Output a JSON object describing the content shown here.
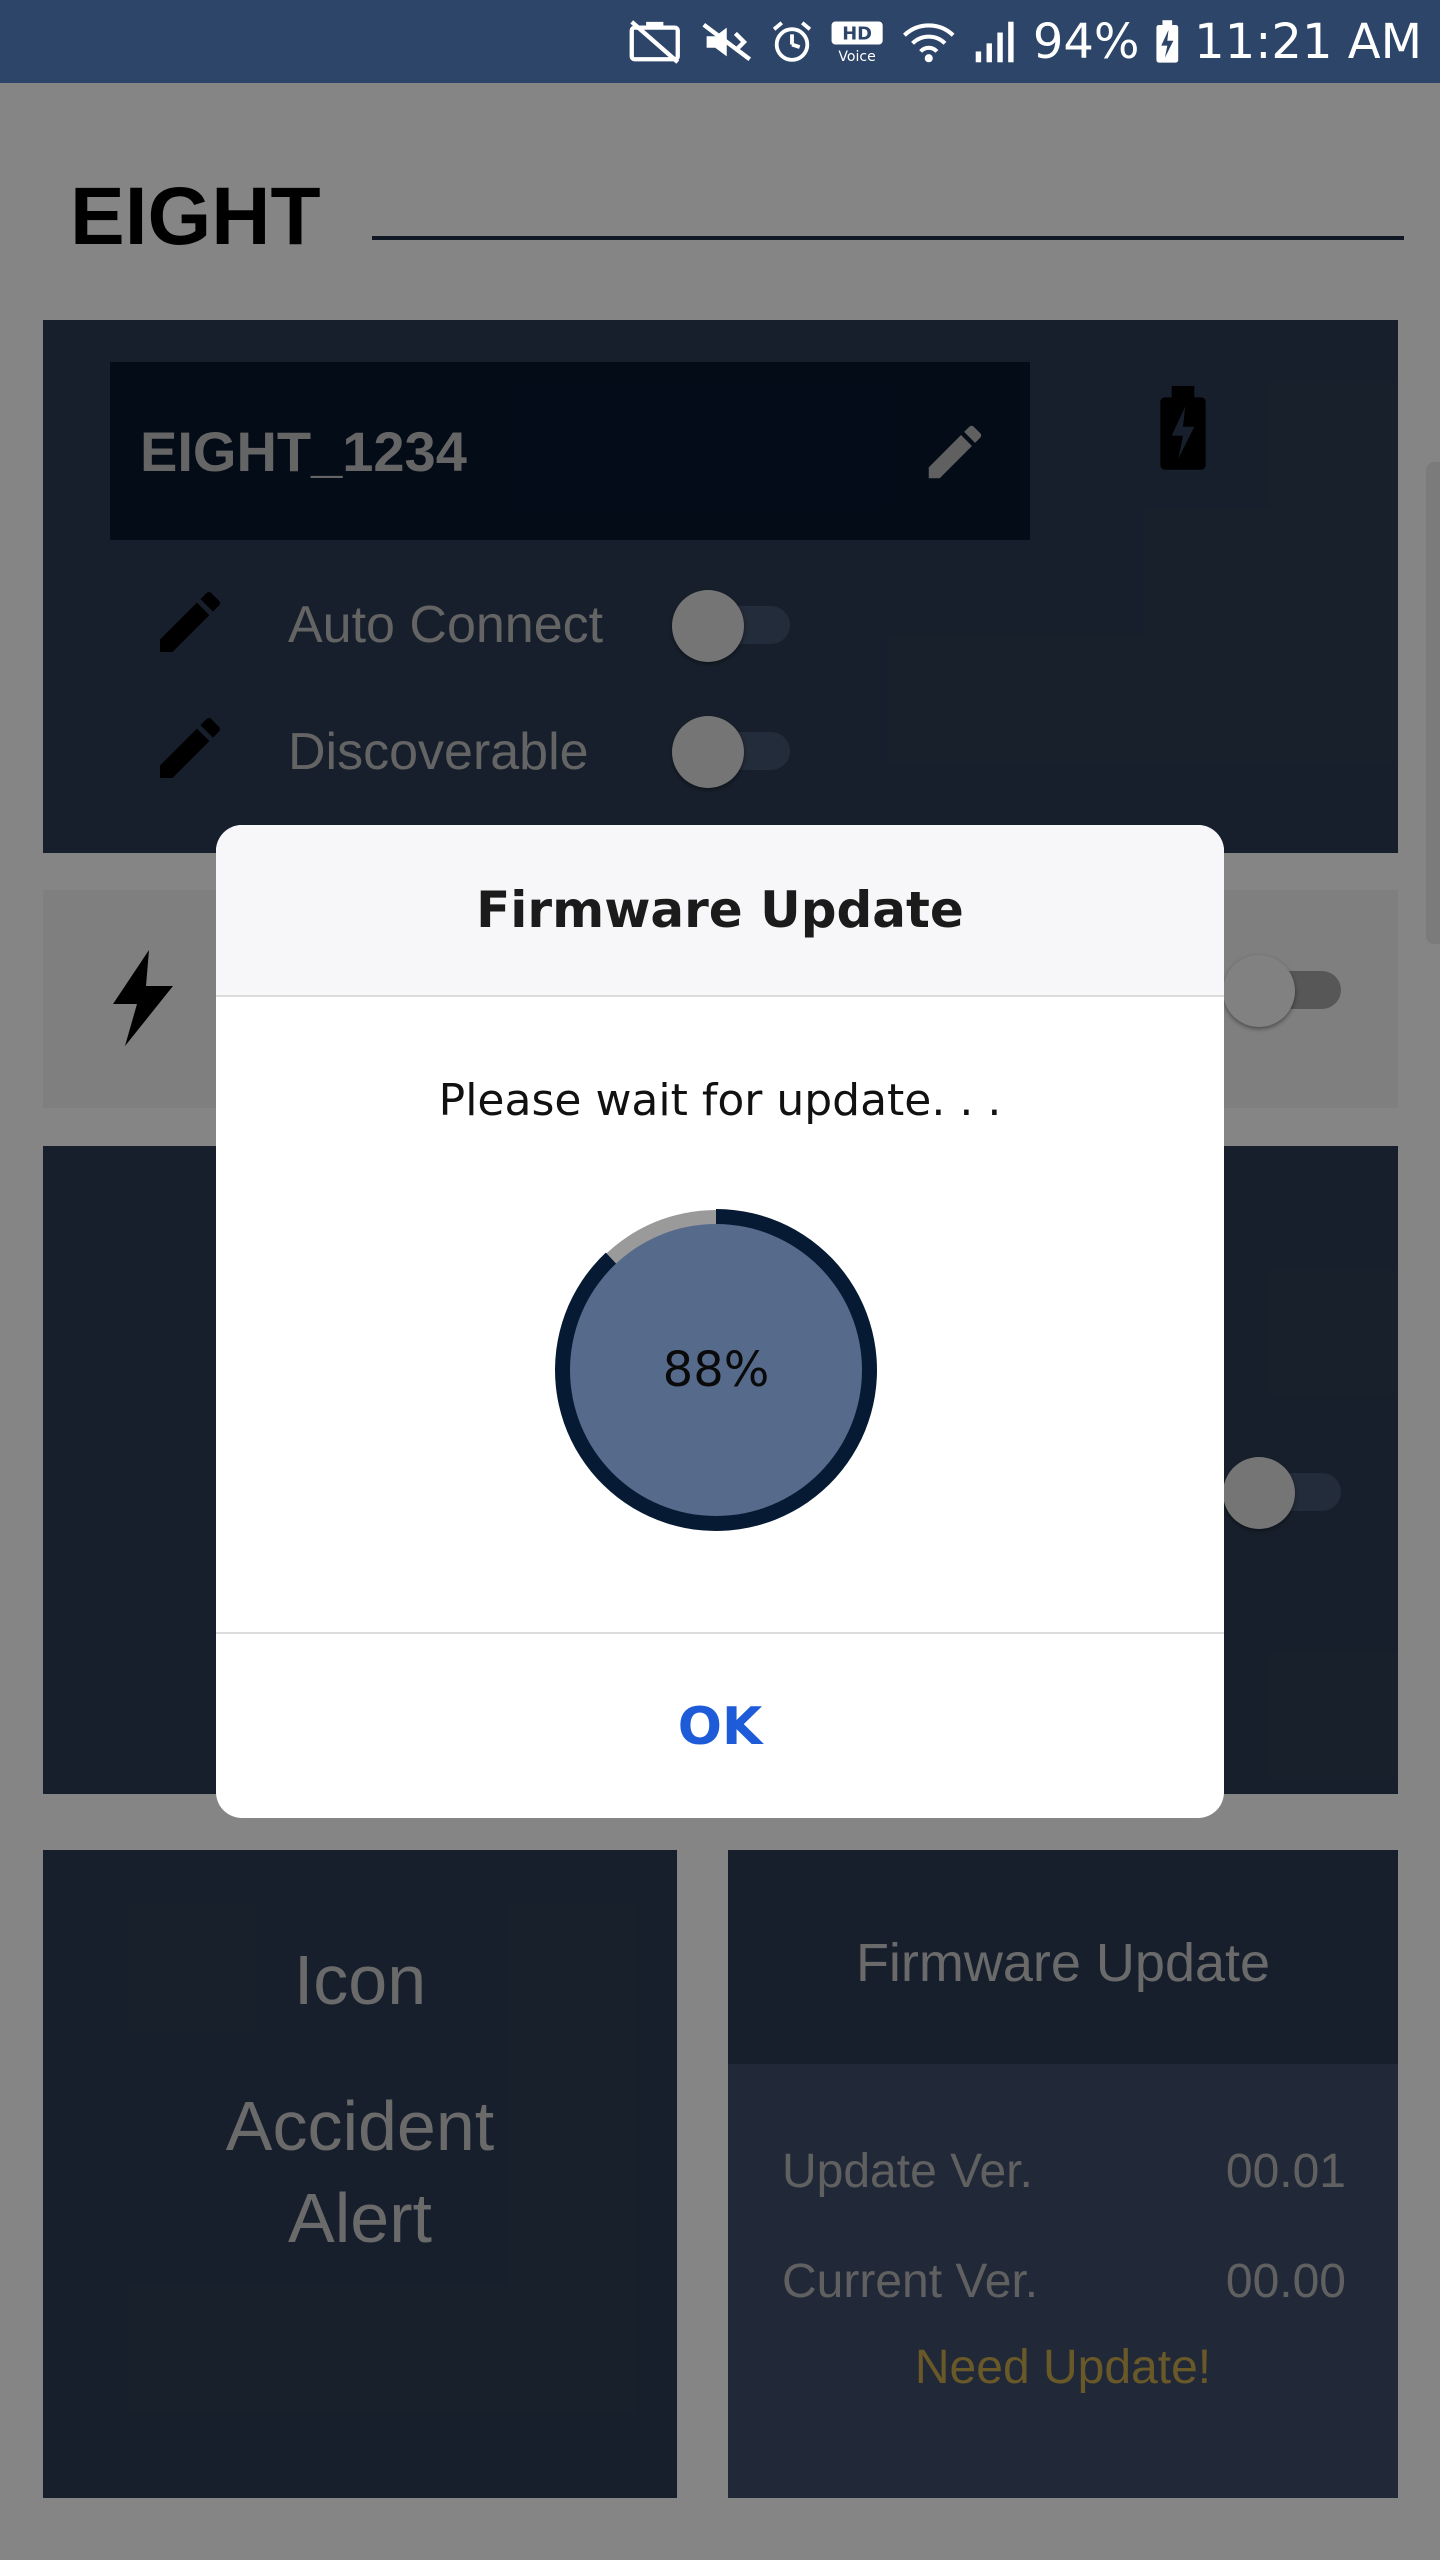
{
  "status_bar": {
    "battery_percent": "94%",
    "time": "11:21 AM",
    "icons": [
      "no-battery-saver-icon",
      "vibrate-mute-icon",
      "alarm-icon",
      "hd-voice-icon",
      "wifi-icon",
      "signal-icon",
      "battery-charging-icon"
    ]
  },
  "app": {
    "title": "EIGHT",
    "device_name": "EIGHT_1234",
    "auto_connect_label": "Auto Connect",
    "discoverable_label": "Discoverable",
    "icon_card": {
      "title": "Icon",
      "subtitle_line1": "Accident",
      "subtitle_line2": "Alert"
    },
    "firmware_card": {
      "title": "Firmware Update",
      "update_ver_label": "Update Ver.",
      "update_ver_value": "00.01",
      "current_ver_label": "Current Ver.",
      "current_ver_value": "00.00",
      "need_update": "Need Update!"
    }
  },
  "dialog": {
    "title": "Firmware Update",
    "message": "Please wait for update. . .",
    "progress_percent": 88,
    "progress_label": "88%",
    "ok_label": "OK"
  },
  "colors": {
    "status_bar": "#2c4568",
    "card_dark": "#2b3a50",
    "progress_ring": "#071a33",
    "progress_fill": "#566b8c",
    "ok_blue": "#1d5bd8",
    "need_update": "#c2a24a"
  }
}
